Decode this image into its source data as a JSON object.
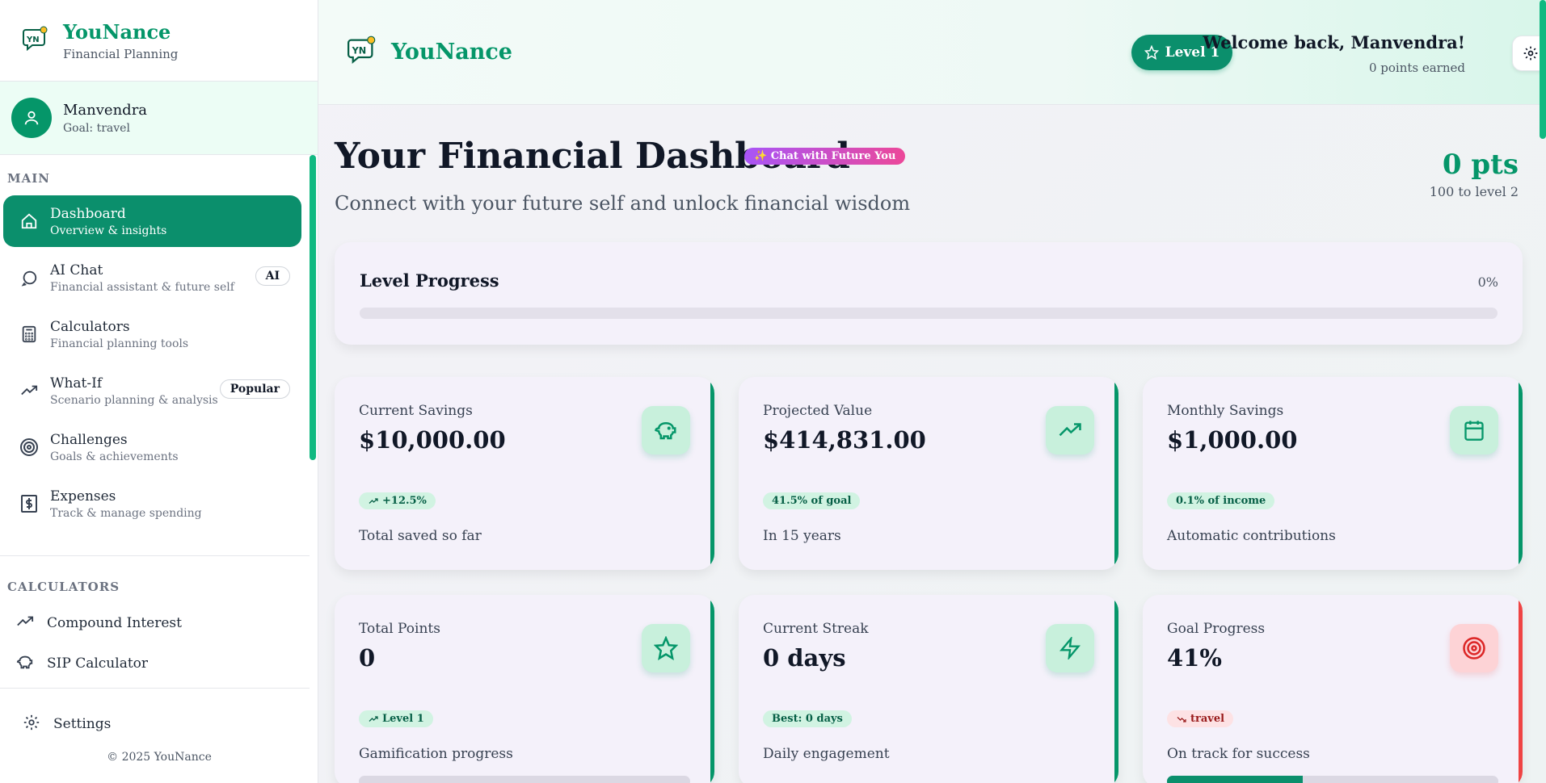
{
  "brand": {
    "name": "YouNance",
    "tagline": "Financial Planning",
    "logo_text": "YN"
  },
  "user": {
    "name": "Manvendra",
    "goal": "Goal: travel"
  },
  "sidebar": {
    "main_label": "MAIN",
    "items": [
      {
        "label": "Dashboard",
        "sub": "Overview & insights",
        "icon": "home-icon",
        "active": true
      },
      {
        "label": "AI Chat",
        "sub": "Financial assistant & future self",
        "icon": "chat-icon",
        "badge": "AI"
      },
      {
        "label": "Calculators",
        "sub": "Financial planning tools",
        "icon": "calculator-icon"
      },
      {
        "label": "What-If",
        "sub": "Scenario planning & analysis",
        "icon": "trend-icon",
        "badge": "Popular"
      },
      {
        "label": "Challenges",
        "sub": "Goals & achievements",
        "icon": "target-icon"
      },
      {
        "label": "Expenses",
        "sub": "Track & manage spending",
        "icon": "dollar-icon"
      }
    ],
    "calc_label": "CALCULATORS",
    "calculators": [
      {
        "label": "Compound Interest",
        "icon": "trend-icon"
      },
      {
        "label": "SIP Calculator",
        "icon": "piggy-bank-icon"
      }
    ],
    "settings_label": "Settings",
    "copyright": "© 2025 YouNance"
  },
  "header": {
    "level_label": "Level 1",
    "welcome": "Welcome back, Manvendra!",
    "points_earned": "0 points earned"
  },
  "page": {
    "title": "Your Financial Dashboard",
    "chat_pill": "✨ Chat with Future You",
    "subtitle": "Connect with your future self and unlock financial wisdom",
    "points": "0 pts",
    "points_to_level": "100 to level 2"
  },
  "level_progress": {
    "title": "Level Progress",
    "percent_label": "0%",
    "progress": 0
  },
  "stats": [
    {
      "title": "Current Savings",
      "value": "$10,000.00",
      "badge": "+12.5%",
      "desc": "Total saved so far",
      "icon": "piggy-bank-icon",
      "accent": "#059669"
    },
    {
      "title": "Projected Value",
      "value": "$414,831.00",
      "badge": "41.5% of goal",
      "desc": "In 15 years",
      "icon": "trend-up-icon",
      "accent": "#059669"
    },
    {
      "title": "Monthly Savings",
      "value": "$1,000.00",
      "badge": "0.1% of income",
      "desc": "Automatic contributions",
      "icon": "calendar-icon",
      "accent": "#059669"
    },
    {
      "title": "Total Points",
      "value": "0",
      "badge": "Level 1",
      "desc": "Gamification progress",
      "icon": "star-icon",
      "accent": "#059669",
      "progress": 0
    },
    {
      "title": "Current Streak",
      "value": "0 days",
      "badge": "Best: 0 days",
      "desc": "Daily engagement",
      "icon": "lightning-icon",
      "accent": "#059669"
    },
    {
      "title": "Goal Progress",
      "value": "41%",
      "badge": "travel",
      "desc": "On track for success",
      "icon": "target-icon",
      "accent": "#ef4444",
      "progress": 0.41
    }
  ]
}
